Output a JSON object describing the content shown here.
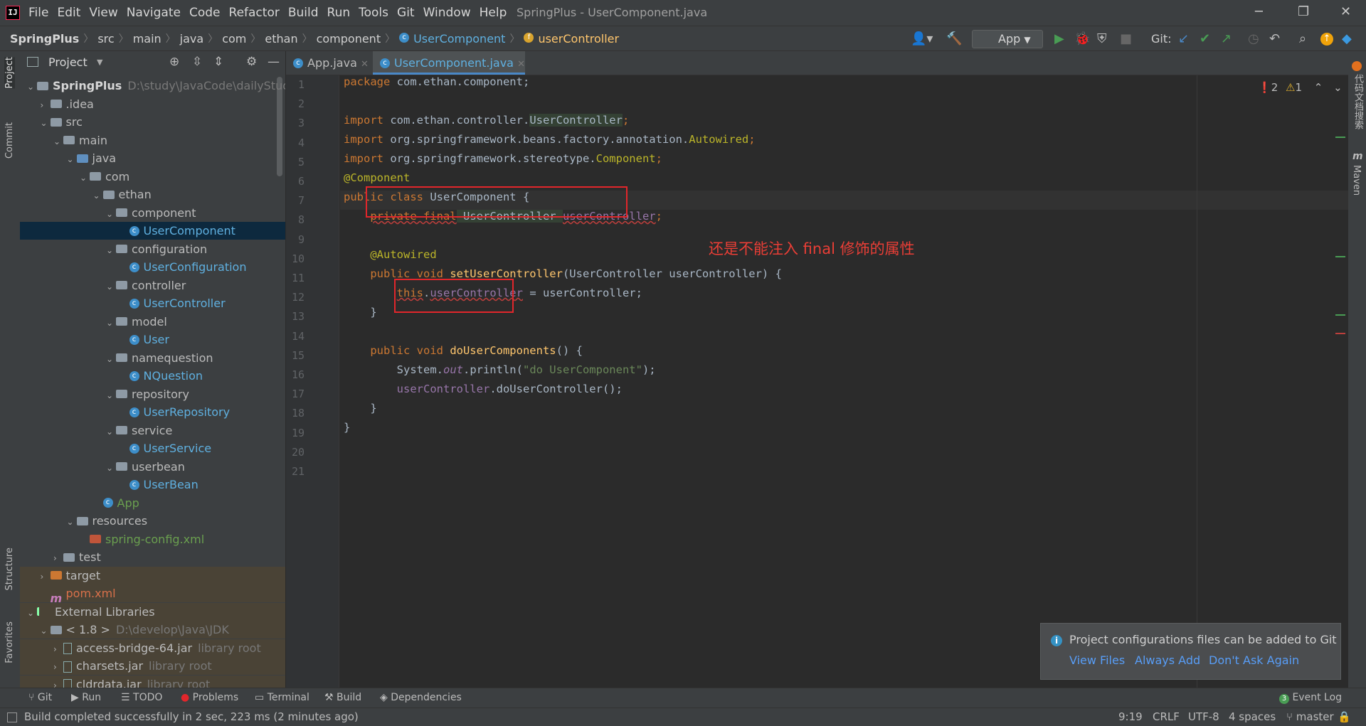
{
  "window": {
    "title": "SpringPlus - UserComponent.java"
  },
  "menu": [
    "File",
    "Edit",
    "View",
    "Navigate",
    "Code",
    "Refactor",
    "Build",
    "Run",
    "Tools",
    "Git",
    "Window",
    "Help"
  ],
  "breadcrumb": [
    "SpringPlus",
    "src",
    "main",
    "java",
    "com",
    "ethan",
    "component",
    "UserComponent",
    "userController"
  ],
  "toolbar": {
    "run_config": "App",
    "git_label": "Git:"
  },
  "project_panel": {
    "title": "Project",
    "tree": [
      {
        "label": "SpringPlus",
        "hint": "D:\\study\\JavaCode\\dailyStudy\\S"
      },
      {
        "label": ".idea"
      },
      {
        "label": "src"
      },
      {
        "label": "main"
      },
      {
        "label": "java"
      },
      {
        "label": "com"
      },
      {
        "label": "ethan"
      },
      {
        "label": "component"
      },
      {
        "label": "UserComponent"
      },
      {
        "label": "configuration"
      },
      {
        "label": "UserConfiguration"
      },
      {
        "label": "controller"
      },
      {
        "label": "UserController"
      },
      {
        "label": "model"
      },
      {
        "label": "User"
      },
      {
        "label": "namequestion"
      },
      {
        "label": "NQuestion"
      },
      {
        "label": "repository"
      },
      {
        "label": "UserRepository"
      },
      {
        "label": "service"
      },
      {
        "label": "UserService"
      },
      {
        "label": "userbean"
      },
      {
        "label": "UserBean"
      },
      {
        "label": "App"
      },
      {
        "label": "resources"
      },
      {
        "label": "spring-config.xml"
      },
      {
        "label": "test"
      },
      {
        "label": "target"
      },
      {
        "label": "pom.xml"
      },
      {
        "label": "External Libraries"
      },
      {
        "label": "< 1.8 >",
        "hint": "D:\\develop\\Java\\JDK"
      },
      {
        "label": "access-bridge-64.jar",
        "hint": "library root"
      },
      {
        "label": "charsets.jar",
        "hint": "library root"
      },
      {
        "label": "cldrdata.jar",
        "hint": "library root"
      }
    ]
  },
  "left_stripe": {
    "project": "Project",
    "commit": "Commit",
    "structure": "Structure",
    "favorites": "Favorites"
  },
  "right_stripe": {
    "plugin": "代码文档搜索",
    "maven": "Maven"
  },
  "editor": {
    "tabs": [
      "App.java",
      "UserComponent.java"
    ],
    "line_numbers": [
      "1",
      "2",
      "3",
      "4",
      "5",
      "6",
      "7",
      "8",
      "9",
      "10",
      "11",
      "12",
      "13",
      "14",
      "15",
      "16",
      "17",
      "18",
      "19",
      "20",
      "21"
    ],
    "inspection": {
      "errors": "2",
      "warnings": "1"
    },
    "code": {
      "l1_kw": "package",
      "l1_rest": " com.ethan.component;",
      "l3_kw": "import",
      "l3_a": " com.ethan.controller.",
      "l3_b": "UserController",
      "l3_c": ";",
      "l4_kw": "import",
      "l4_a": " org.springframework.beans.factory.annotation.",
      "l4_b": "Autowired",
      "l4_c": ";",
      "l5_kw": "import",
      "l5_a": " org.springframework.stereotype.",
      "l5_b": "Component",
      "l5_c": ";",
      "l7": "@Component",
      "l8_kw": "public class",
      "l8_rest": " UserComponent {",
      "l9_kw": "private final",
      "l9_type": " UserController ",
      "l9_field": "userController",
      "l9_semi": ";",
      "l11": "@Autowired",
      "l12_kw": "public void",
      "l12_m": " setUserController",
      "l12_rest": "(UserController userController) {",
      "l13_this": "this",
      "l13_dot": ".",
      "l13_field": "userController",
      "l13_rest": " = userController;",
      "l14": "}",
      "l16_kw": "public void",
      "l16_m": " doUserComponents",
      "l16_rest": "() {",
      "l17_a": "System.",
      "l17_out": "out",
      "l17_b": ".println(",
      "l17_str": "\"do UserComponent\"",
      "l17_c": ");",
      "l18_field": "userController",
      "l18_rest": ".doUserController();",
      "l19": "}",
      "l20": "}"
    }
  },
  "annotation_note": "还是不能注入 final 修饰的属性",
  "notification": {
    "message": "Project configurations files can be added to Git",
    "links": [
      "View Files",
      "Always Add",
      "Don't Ask Again"
    ]
  },
  "bottom_tools": [
    "Git",
    "Run",
    "TODO",
    "Problems",
    "Terminal",
    "Build",
    "Dependencies"
  ],
  "event_log": {
    "count": "3",
    "label": "Event Log"
  },
  "status": {
    "message": "Build completed successfully in 2 sec, 223 ms (2 minutes ago)",
    "position": "9:19",
    "line_sep": "CRLF",
    "encoding": "UTF-8",
    "indent": "4 spaces",
    "branch": "master"
  },
  "colors": {
    "accent": "#4a88c7",
    "error": "#e2262b",
    "note": "#ea3e36",
    "link": "#589df6"
  }
}
